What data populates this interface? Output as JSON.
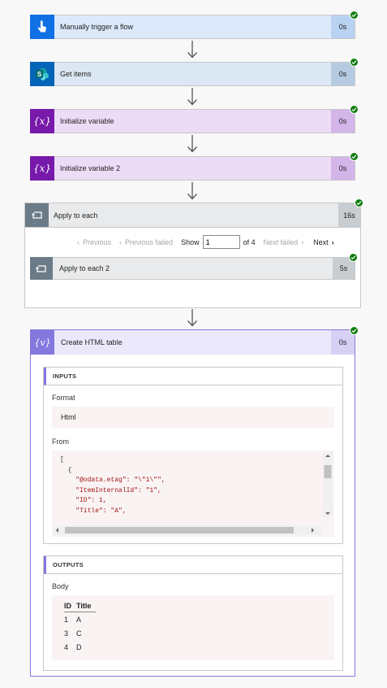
{
  "steps": [
    {
      "title": "Manually trigger a flow",
      "duration": "0s",
      "icon": "hand-touch-icon",
      "color": "#1170e4"
    },
    {
      "title": "Get items",
      "duration": "0s",
      "icon": "sharepoint-icon",
      "color": "#0364b8"
    },
    {
      "title": "Initialize variable",
      "duration": "0s",
      "icon": "variable-icon",
      "color": "#7719aa"
    },
    {
      "title": "Initialize variable 2",
      "duration": "0s",
      "icon": "variable-icon",
      "color": "#7719aa"
    }
  ],
  "apply_to_each": {
    "title": "Apply to each",
    "duration": "16s",
    "pager": {
      "previous": "Previous",
      "previous_failed": "Previous failed",
      "show": "Show",
      "page": "1",
      "of": "of 4",
      "next_failed": "Next failed",
      "next": "Next"
    },
    "inner": {
      "title": "Apply to each 2",
      "duration": "5s"
    }
  },
  "create_html_table": {
    "title": "Create HTML table",
    "duration": "0s",
    "inputs": {
      "header": "INPUTS",
      "format_label": "Format",
      "format_value": "Html",
      "from_label": "From",
      "from_lines": [
        "[",
        "  {",
        "    \"@odata.etag\": \"\\\"1\\\"\",",
        "    \"ItemInternalId\": \"1\",",
        "    \"ID\": 1,",
        "    \"Title\": \"A\","
      ]
    },
    "outputs": {
      "header": "OUTPUTS",
      "body_label": "Body",
      "table_headers": [
        "ID",
        "Title"
      ],
      "table_rows": [
        [
          "1",
          "A"
        ],
        [
          "3",
          "C"
        ],
        [
          "4",
          "D"
        ]
      ]
    }
  },
  "colors": {
    "success": "#107c10",
    "accent": "#8378de"
  }
}
